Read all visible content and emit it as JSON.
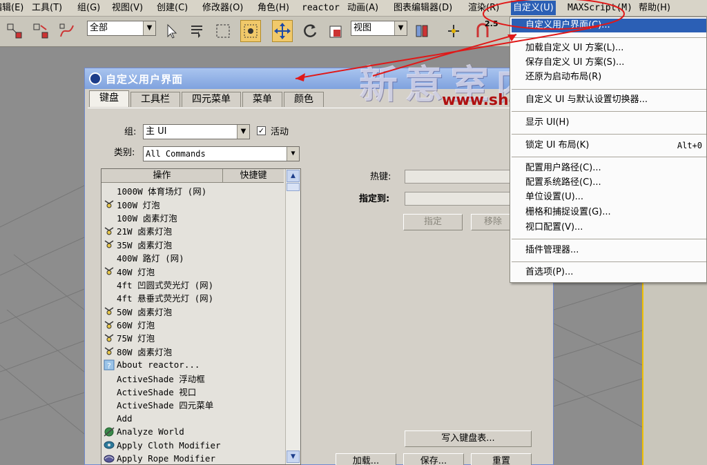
{
  "menubar": {
    "items": [
      {
        "label": "编辑(E)",
        "left": 0
      },
      {
        "label": "工具(T)"
      },
      {
        "label": "组(G)"
      },
      {
        "label": "视图(V)"
      },
      {
        "label": "创建(C)"
      },
      {
        "label": "修改器(O)"
      },
      {
        "label": "角色(H)"
      },
      {
        "label": "reactor"
      },
      {
        "label": "动画(A)"
      },
      {
        "label": "图表编辑器(D)"
      },
      {
        "label": "渲染(R)"
      },
      {
        "label": "自定义(U)"
      },
      {
        "label": "MAXScript(M)"
      },
      {
        "label": "帮助(H)"
      }
    ]
  },
  "toolbar": {
    "selection_filter": "全部",
    "coord_system": "视图",
    "snap_value": "2.5"
  },
  "dialog": {
    "title": "自定义用户界面",
    "tabs": [
      "键盘",
      "工具栏",
      "四元菜单",
      "菜单",
      "颜色"
    ],
    "group_label": "组:",
    "group_value": "主 UI",
    "active_label": "活动",
    "category_label": "类别:",
    "category_value": "All Commands",
    "list_headers": [
      "操作",
      "快捷键"
    ],
    "actions": [
      {
        "icon": "none",
        "label": "1000W 体育场灯 (网)"
      },
      {
        "icon": "lamp",
        "label": "100W 灯泡"
      },
      {
        "icon": "none",
        "label": "100W 卤素灯泡"
      },
      {
        "icon": "lamp",
        "label": "21W 卤素灯泡"
      },
      {
        "icon": "lamp",
        "label": "35W 卤素灯泡"
      },
      {
        "icon": "none",
        "label": "400W 路灯 (网)"
      },
      {
        "icon": "lamp",
        "label": "40W 灯泡"
      },
      {
        "icon": "none",
        "label": "4ft 凹圆式荧光灯 (网)"
      },
      {
        "icon": "none",
        "label": "4ft 悬垂式荧光灯 (网)"
      },
      {
        "icon": "lamp",
        "label": "50W 卤素灯泡"
      },
      {
        "icon": "lamp",
        "label": "60W 灯泡"
      },
      {
        "icon": "lamp",
        "label": "75W 灯泡"
      },
      {
        "icon": "lamp",
        "label": "80W 卤素灯泡"
      },
      {
        "icon": "help",
        "label": "About reactor..."
      },
      {
        "icon": "none",
        "label": "ActiveShade 浮动框"
      },
      {
        "icon": "none",
        "label": "ActiveShade 视口"
      },
      {
        "icon": "none",
        "label": "ActiveShade 四元菜单"
      },
      {
        "icon": "none",
        "label": "Add"
      },
      {
        "icon": "world",
        "label": "Analyze World"
      },
      {
        "icon": "cloth",
        "label": "Apply Cloth Modifier"
      },
      {
        "icon": "rope",
        "label": "Apply Rope Modifier"
      }
    ],
    "hotkey_label": "热键:",
    "assigned_label": "指定到:",
    "assign_button": "指定",
    "remove_button": "移除",
    "write_keyboard_button": "写入键盘表...",
    "load_button": "加载...",
    "save_button": "保存...",
    "reset_button": "重置"
  },
  "dropdown": {
    "items": [
      {
        "label": "自定义用户界面(C)...",
        "selected": true
      },
      {
        "label": "加载自定义 UI 方案(L)..."
      },
      {
        "label": "保存自定义 UI 方案(S)..."
      },
      {
        "label": "还原为启动布局(R)"
      },
      {
        "label": "自定义 UI 与默认设置切换器..."
      },
      {
        "label": "显示 UI(H)"
      },
      {
        "label": "锁定 UI 布局(K)",
        "shortcut": "Alt+0"
      },
      {
        "label": "配置用户路径(C)..."
      },
      {
        "label": "配置系统路径(C)..."
      },
      {
        "label": "单位设置(U)..."
      },
      {
        "label": "栅格和捕捉设置(G)..."
      },
      {
        "label": "视口配置(V)..."
      },
      {
        "label": "插件管理器..."
      },
      {
        "label": "首选项(P)..."
      }
    ]
  },
  "watermark": {
    "text": "新意室内设计培训",
    "url": "www.shejiedu.com"
  },
  "colors": {
    "menu_highlight": "#2b5fb5",
    "annotation": "#e01818",
    "active_tool": "#f1c96a"
  }
}
